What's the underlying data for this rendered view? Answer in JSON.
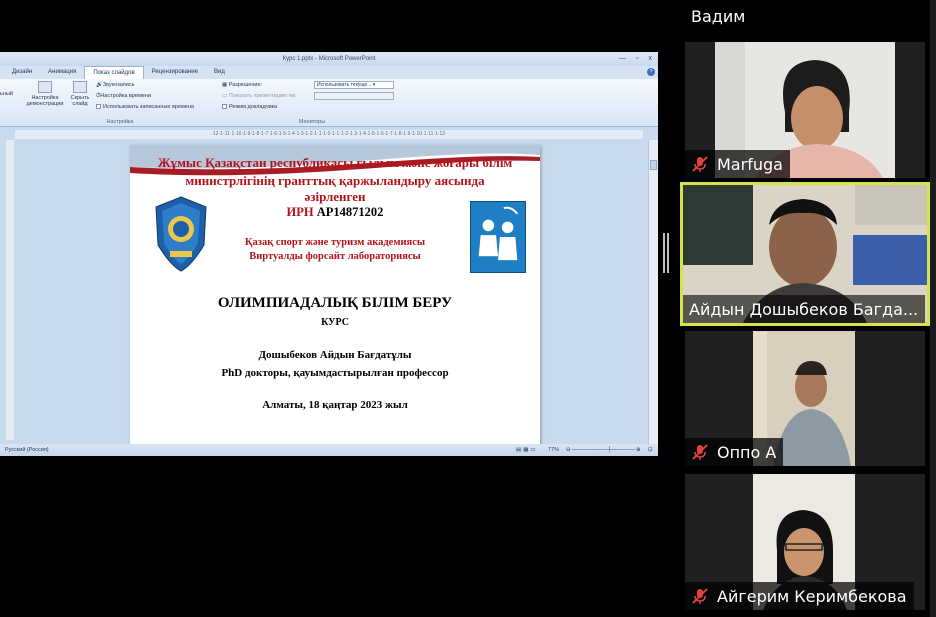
{
  "ppt": {
    "window_title": "Курс 1.pptx - Microsoft PowerPoint",
    "win_min": "—",
    "win_max": "▫",
    "win_close": "x",
    "tabs": [
      "Дизайн",
      "Анимация",
      "Показ слайдов",
      "Рецензирование",
      "Вид"
    ],
    "active_tab": "Показ слайдов",
    "ribbon": {
      "partial_label": "ьный",
      "setup_show": "Настройка демонстрации",
      "hide_slide": "Скрыть слайд",
      "record_narration": "Звукозапись",
      "rehearse_timings": "Настройка времени",
      "use_rehearsed": "Использовать записанные времена",
      "group_setup": "Настройка",
      "resolution_label": "Разрешение:",
      "resolution_value": "Использовать текуще...",
      "show_on_label": "Показать презентацию на:",
      "presenter_view": "Режим докладчика",
      "group_monitors": "Мониторы"
    },
    "ruler": "·12·1·11·1·10·1·9·1·8·1·7·1·6·1·5·1·4·1·3·1·2·1·1·1·0·1·1·1·2·1·3·1·4·1·5·1·6·1·7·1·8·1·9·1·10·1·11·1·12·",
    "status": {
      "language": "Русский (Россия)",
      "zoom": "77%"
    }
  },
  "slide": {
    "header_line1": "Жұмыс Қазақстан республикасы ғылым және жоғары білім",
    "header_line2": "министрлігінің гранттық қаржыландыру аясында",
    "header_line3": "әзірленген",
    "irn_label": "ИРН",
    "irn_value": "АР14871202",
    "academy": "Қазақ спорт және туризм академиясы",
    "lab": "Виртуалды форсайт лабораториясы",
    "title": "ОЛИМПИАДАЛЫҚ БІЛІМ БЕРУ",
    "subtitle": "КУРС",
    "author": "Дошыбеков Айдын Бағдатұлы",
    "degree": "PhD докторы, қауымдастырылған профессор",
    "place_date": "Алматы, 18 қаңтар 2023 жыл"
  },
  "participants": {
    "top_name": "Вадим",
    "tiles": [
      {
        "name": "Marfuga",
        "muted": true
      },
      {
        "name": "Айдын Дошыбеков Багда...",
        "muted": false,
        "active_speaker": true
      },
      {
        "name": "Оппо А",
        "muted": true
      },
      {
        "name": "Айгерим Керимбекова",
        "muted": true
      }
    ]
  },
  "colors": {
    "active_speaker_border": "#d7e34a",
    "muted_icon": "#e5433a",
    "slide_red": "#b3141b"
  }
}
